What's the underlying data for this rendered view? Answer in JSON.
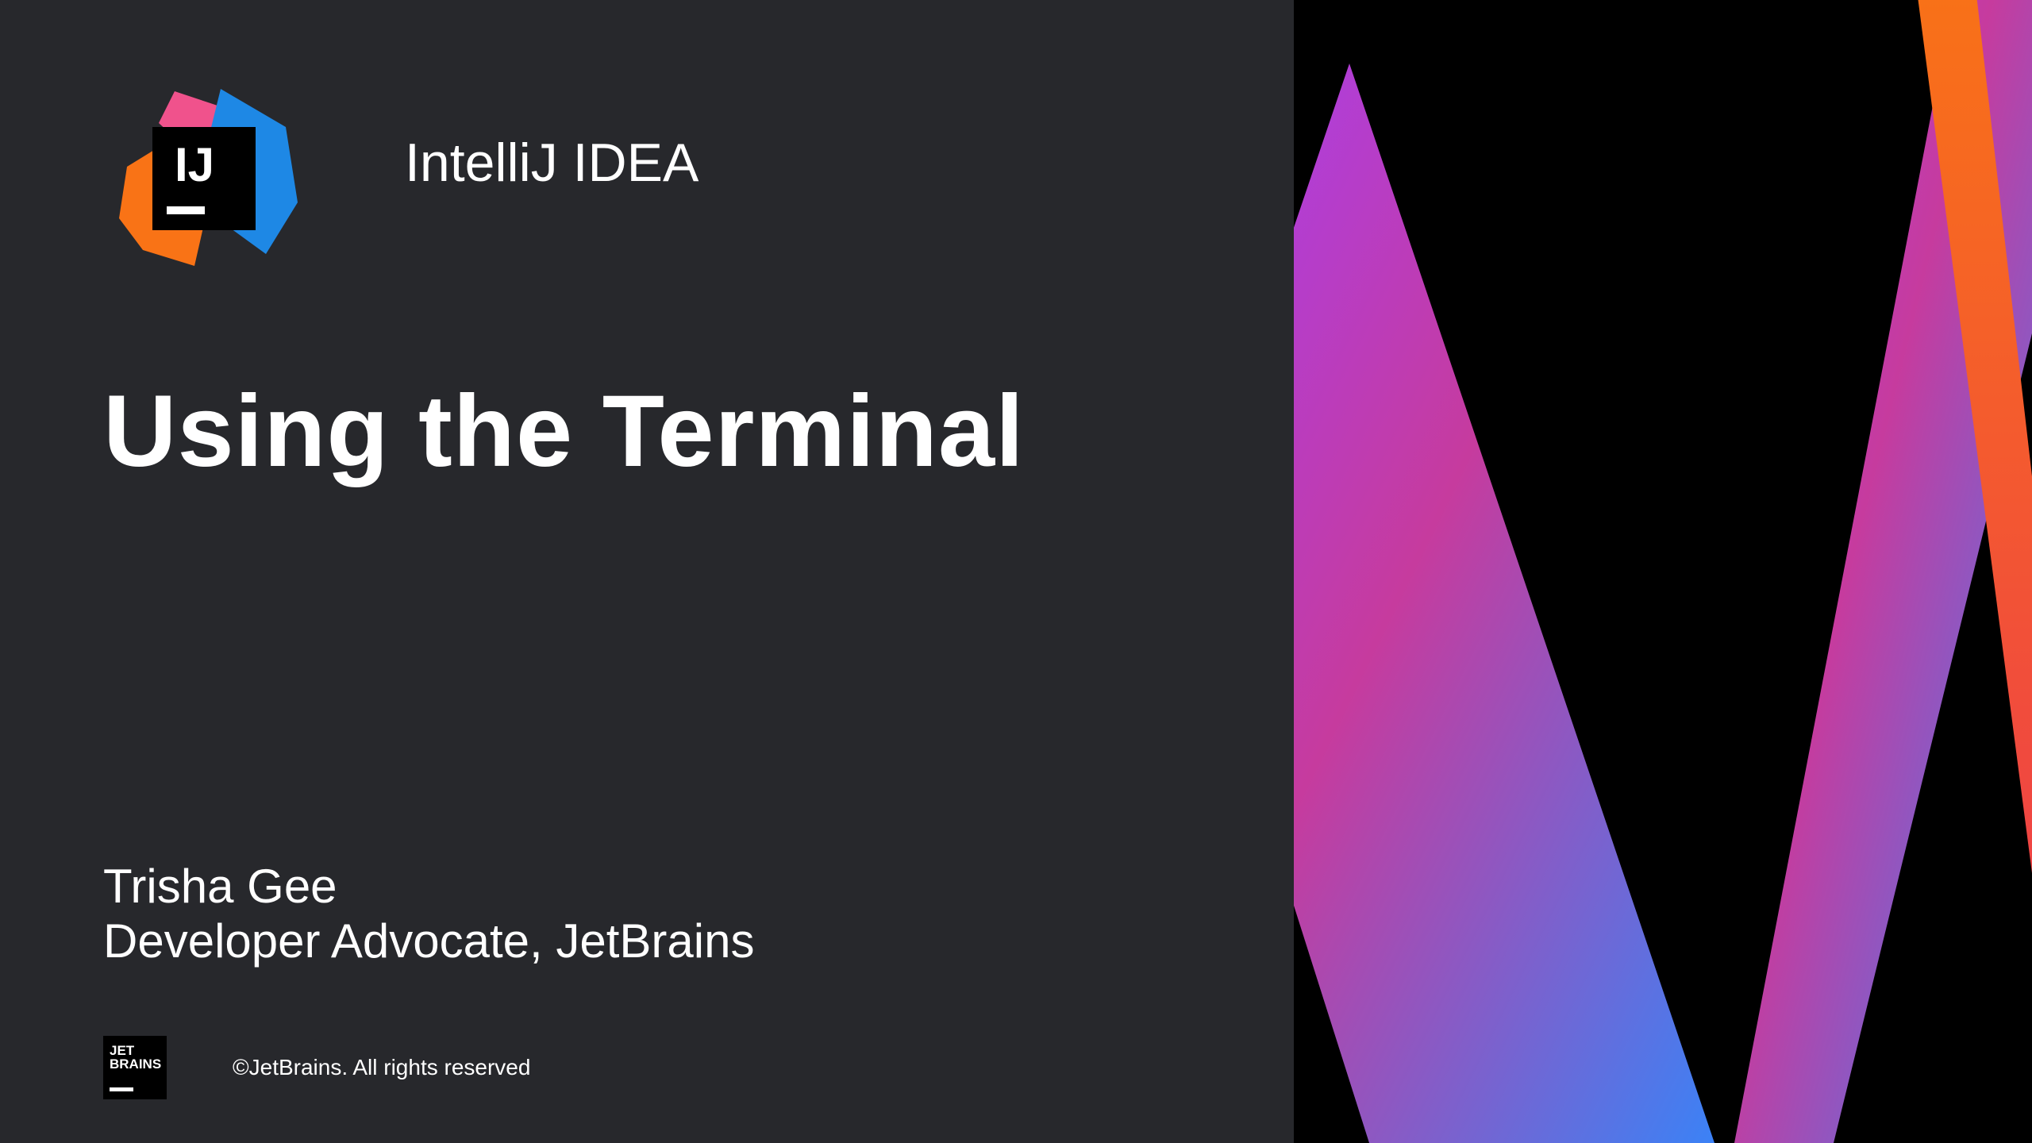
{
  "header": {
    "product_name": "IntelliJ IDEA",
    "logo_label": "IJ"
  },
  "main": {
    "title": "Using the Terminal"
  },
  "presenter": {
    "name": "Trisha Gee",
    "title": "Developer Advocate, JetBrains"
  },
  "footer": {
    "company_logo_line1": "JET",
    "company_logo_line2": "BRAINS",
    "copyright": "©JetBrains. All rights reserved"
  }
}
